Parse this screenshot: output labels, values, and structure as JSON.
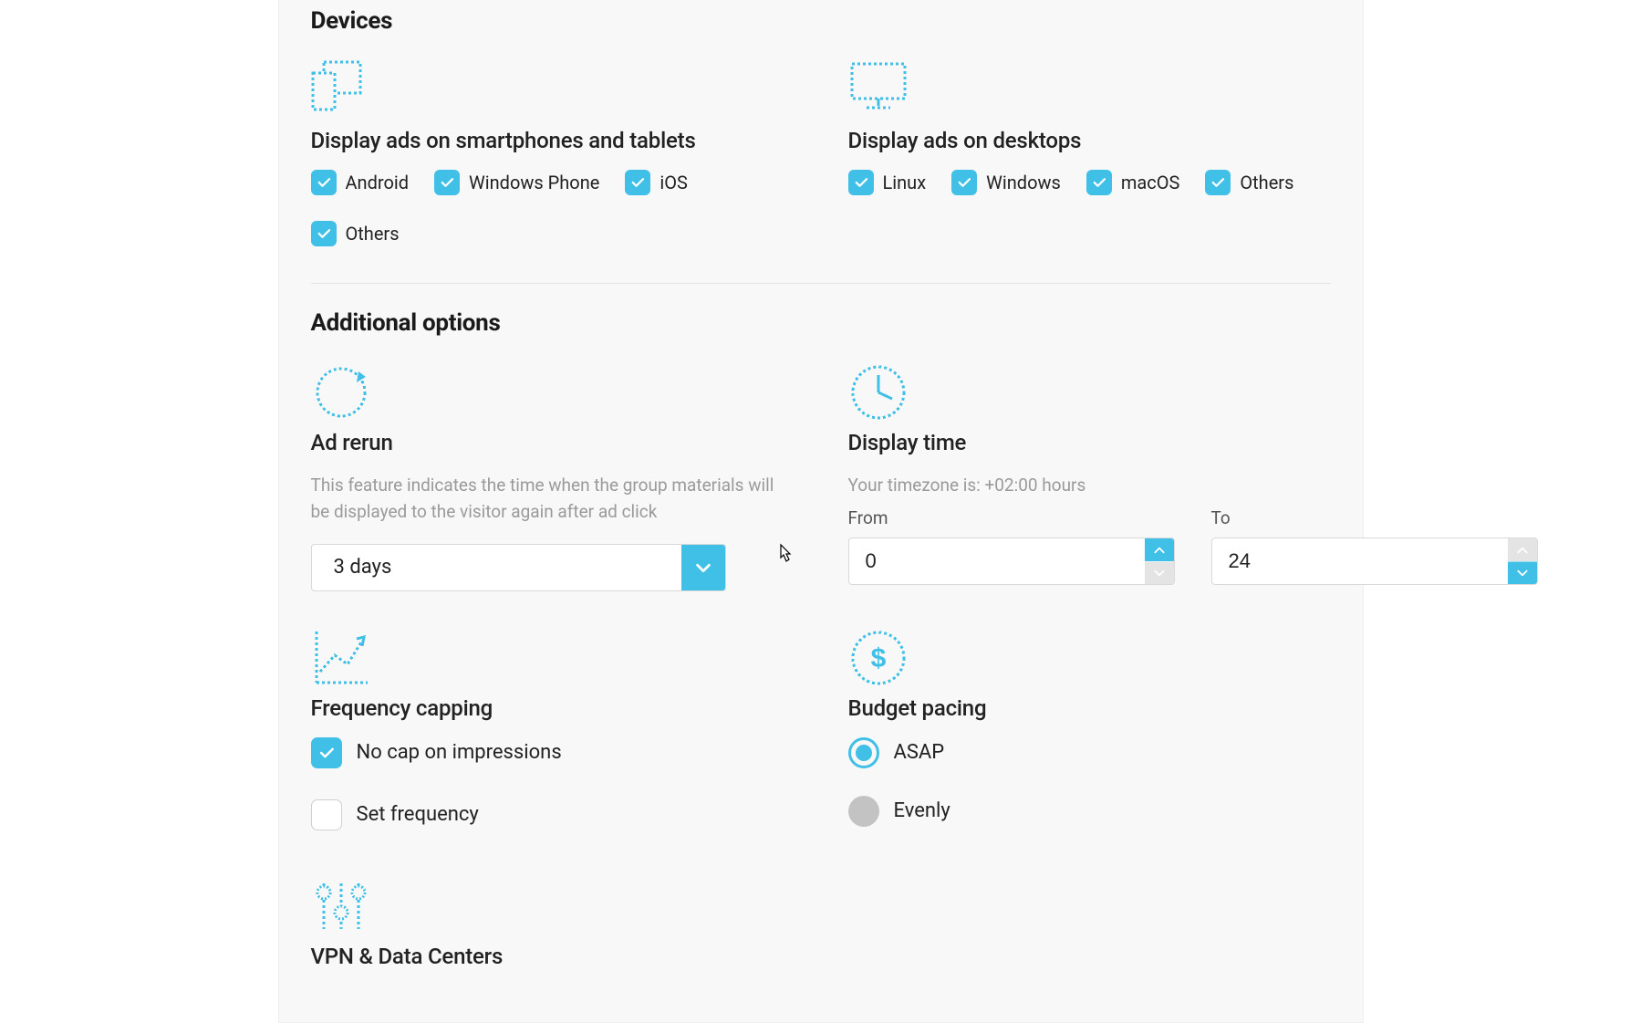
{
  "colors": {
    "accent": "#40c0e7"
  },
  "devices": {
    "title": "Devices",
    "mobile": {
      "heading": "Display ads on smartphones and tablets",
      "options": [
        {
          "label": "Android",
          "checked": true
        },
        {
          "label": "Windows Phone",
          "checked": true
        },
        {
          "label": "iOS",
          "checked": true
        },
        {
          "label": "Others",
          "checked": true
        }
      ]
    },
    "desktop": {
      "heading": "Display ads on desktops",
      "options": [
        {
          "label": "Linux",
          "checked": true
        },
        {
          "label": "Windows",
          "checked": true
        },
        {
          "label": "macOS",
          "checked": true
        },
        {
          "label": "Others",
          "checked": true
        }
      ]
    }
  },
  "additional": {
    "title": "Additional options",
    "ad_rerun": {
      "heading": "Ad rerun",
      "helper": "This feature indicates the time when the group materials will be displayed to the visitor again after ad click",
      "value": "3 days"
    },
    "display_time": {
      "heading": "Display time",
      "helper": "Your timezone is: +02:00 hours",
      "from_label": "From",
      "from_value": "0",
      "to_label": "To",
      "to_value": "24"
    },
    "frequency_capping": {
      "heading": "Frequency capping",
      "options": [
        {
          "label": "No cap on impressions",
          "checked": true
        },
        {
          "label": "Set frequency",
          "checked": false
        }
      ]
    },
    "budget_pacing": {
      "heading": "Budget pacing",
      "options": [
        {
          "label": "ASAP",
          "selected": true
        },
        {
          "label": "Evenly",
          "selected": false
        }
      ]
    },
    "vpn": {
      "heading": "VPN & Data Centers"
    }
  }
}
